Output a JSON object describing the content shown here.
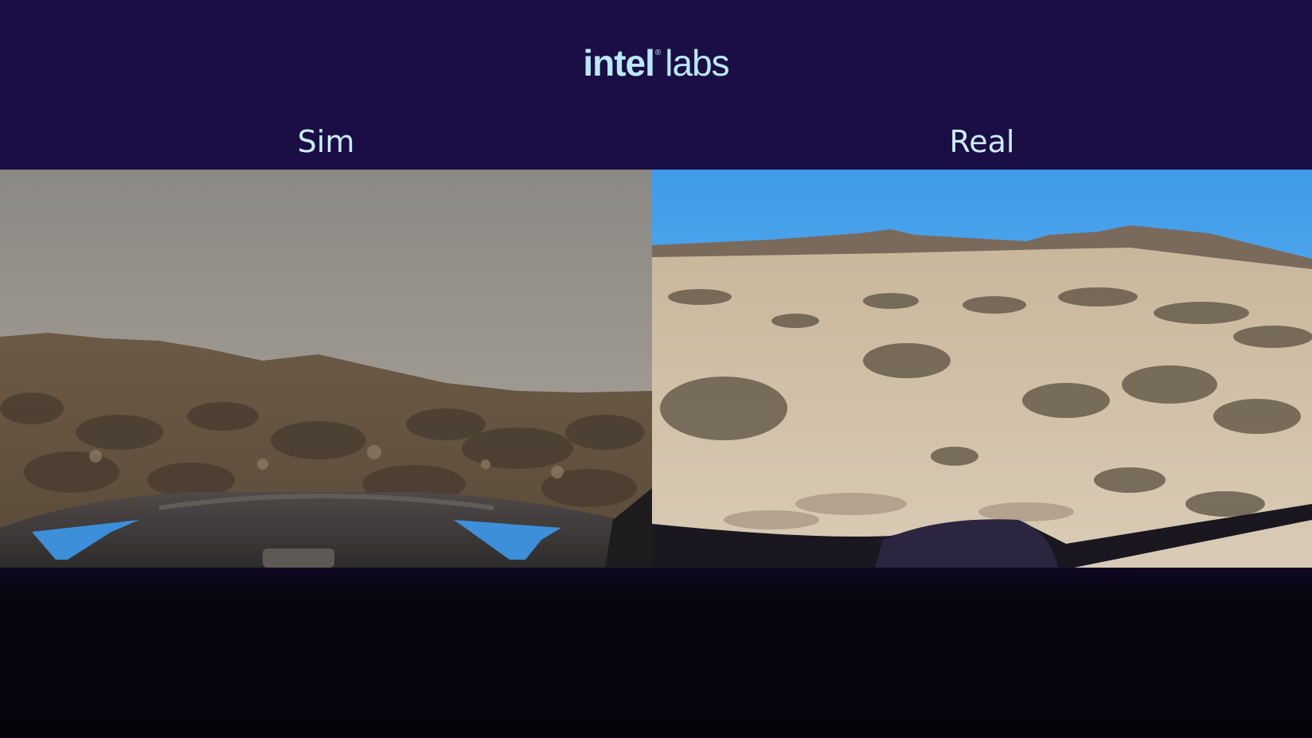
{
  "logo": {
    "brand": "intel",
    "mark": "®",
    "product": "labs"
  },
  "panels": {
    "left_label": "Sim",
    "right_label": "Real"
  },
  "colors": {
    "background": "#1b0e44",
    "text": "#c9ecfa"
  }
}
